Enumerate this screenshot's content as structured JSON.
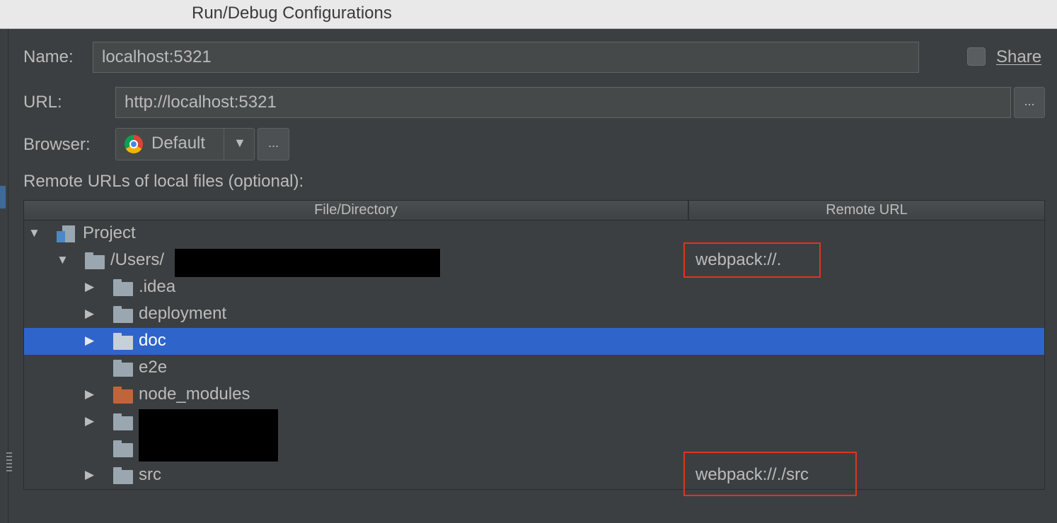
{
  "window": {
    "title": "Run/Debug Configurations"
  },
  "form": {
    "name_label": "Name:",
    "name_value": "localhost:5321",
    "share_label": "Share",
    "url_label": "URL:",
    "url_value": "http://localhost:5321",
    "browse_label": "...",
    "browser_label": "Browser:",
    "browser_value": "Default",
    "browser_more_label": "...",
    "remote_section_label": "Remote URLs of local files (optional):"
  },
  "table": {
    "columns": [
      "File/Directory",
      "Remote URL"
    ],
    "rows": [
      {
        "name": "Project",
        "remote": "",
        "expanded": true,
        "icon": "project-icon"
      },
      {
        "name": "/Users/",
        "remote": "webpack://.",
        "expanded": true,
        "icon": "folder-icon"
      },
      {
        "name": ".idea",
        "remote": "",
        "expanded": false,
        "icon": "folder-icon"
      },
      {
        "name": "deployment",
        "remote": "",
        "expanded": false,
        "icon": "folder-icon"
      },
      {
        "name": "doc",
        "remote": "",
        "expanded": false,
        "icon": "folder-icon",
        "selected": true
      },
      {
        "name": "e2e",
        "remote": "",
        "icon": "folder-icon"
      },
      {
        "name": "node_modules",
        "remote": "",
        "expanded": false,
        "icon": "excluded-folder-icon"
      },
      {
        "name": "",
        "remote": "",
        "expanded": false,
        "icon": "folder-icon",
        "redacted": true
      },
      {
        "name": "",
        "remote": "",
        "icon": "folder-icon",
        "redacted": true
      },
      {
        "name": "src",
        "remote": "webpack://./src",
        "expanded": false,
        "icon": "folder-icon"
      }
    ]
  },
  "colors": {
    "background": "#3c3f41",
    "selection": "#2f65ca",
    "highlight_box": "#e0341f",
    "excluded_folder": "#c0653a"
  }
}
